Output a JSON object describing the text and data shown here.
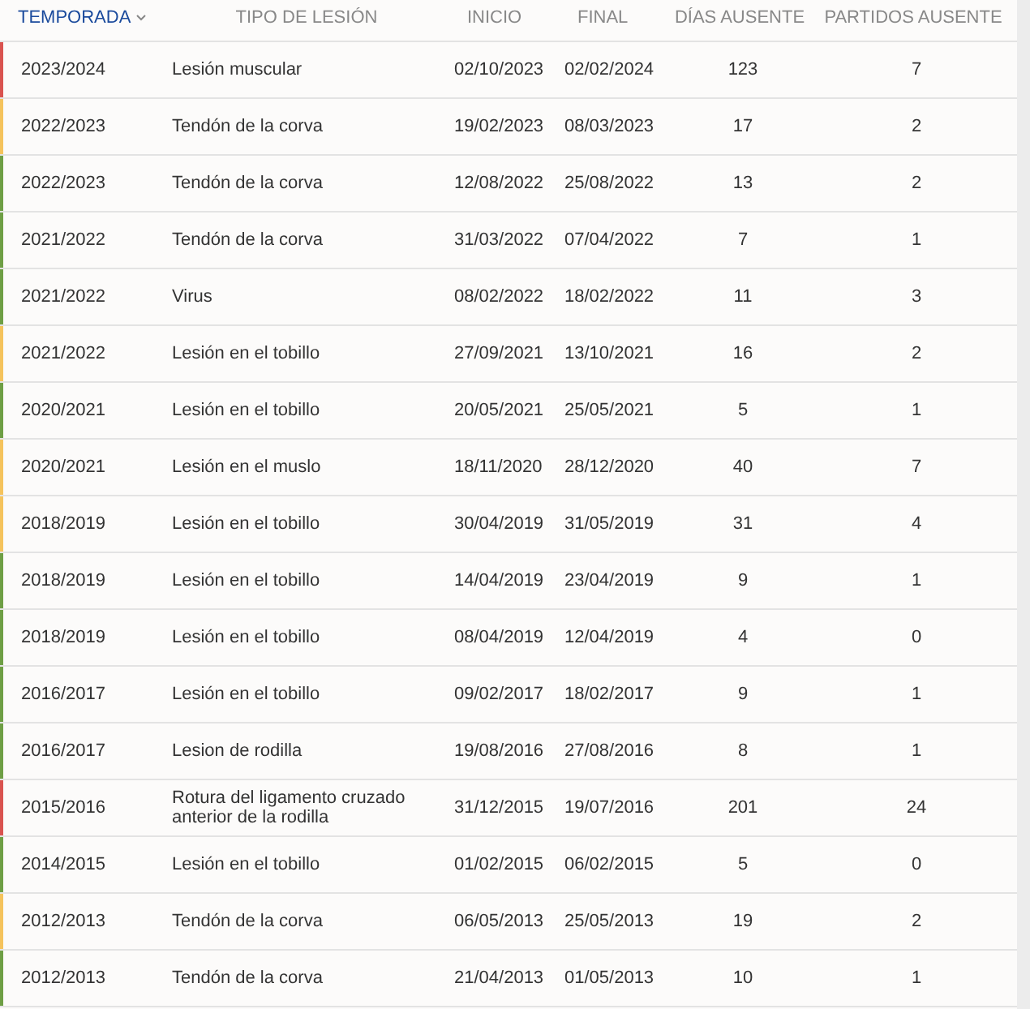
{
  "table": {
    "columns": [
      {
        "label": "TEMPORADA",
        "selected": true
      },
      {
        "label": "TIPO DE LESIÓN",
        "selected": false
      },
      {
        "label": "INICIO",
        "selected": false
      },
      {
        "label": "FINAL",
        "selected": false
      },
      {
        "label": "DÍAS AUSENTE",
        "selected": false
      },
      {
        "label": "PARTIDOS AUSENTE",
        "selected": false
      }
    ],
    "rows": [
      {
        "color": "#d9534f",
        "season": "2023/2024",
        "injury": "Lesión muscular",
        "start": "02/10/2023",
        "end": "02/02/2024",
        "days": "123",
        "games": "7"
      },
      {
        "color": "#f5c35c",
        "season": "2022/2023",
        "injury": "Tendón de la corva",
        "start": "19/02/2023",
        "end": "08/03/2023",
        "days": "17",
        "games": "2"
      },
      {
        "color": "#6e9f45",
        "season": "2022/2023",
        "injury": "Tendón de la corva",
        "start": "12/08/2022",
        "end": "25/08/2022",
        "days": "13",
        "games": "2"
      },
      {
        "color": "#6e9f45",
        "season": "2021/2022",
        "injury": "Tendón de la corva",
        "start": "31/03/2022",
        "end": "07/04/2022",
        "days": "7",
        "games": "1"
      },
      {
        "color": "#6e9f45",
        "season": "2021/2022",
        "injury": "Virus",
        "start": "08/02/2022",
        "end": "18/02/2022",
        "days": "11",
        "games": "3"
      },
      {
        "color": "#f5c35c",
        "season": "2021/2022",
        "injury": "Lesión en el tobillo",
        "start": "27/09/2021",
        "end": "13/10/2021",
        "days": "16",
        "games": "2"
      },
      {
        "color": "#6e9f45",
        "season": "2020/2021",
        "injury": "Lesión en el tobillo",
        "start": "20/05/2021",
        "end": "25/05/2021",
        "days": "5",
        "games": "1"
      },
      {
        "color": "#f5c35c",
        "season": "2020/2021",
        "injury": "Lesión en el muslo",
        "start": "18/11/2020",
        "end": "28/12/2020",
        "days": "40",
        "games": "7"
      },
      {
        "color": "#f5c35c",
        "season": "2018/2019",
        "injury": "Lesión en el tobillo",
        "start": "30/04/2019",
        "end": "31/05/2019",
        "days": "31",
        "games": "4"
      },
      {
        "color": "#6e9f45",
        "season": "2018/2019",
        "injury": "Lesión en el tobillo",
        "start": "14/04/2019",
        "end": "23/04/2019",
        "days": "9",
        "games": "1"
      },
      {
        "color": "#6e9f45",
        "season": "2018/2019",
        "injury": "Lesión en el tobillo",
        "start": "08/04/2019",
        "end": "12/04/2019",
        "days": "4",
        "games": "0"
      },
      {
        "color": "#6e9f45",
        "season": "2016/2017",
        "injury": "Lesión en el tobillo",
        "start": "09/02/2017",
        "end": "18/02/2017",
        "days": "9",
        "games": "1"
      },
      {
        "color": "#6e9f45",
        "season": "2016/2017",
        "injury": "Lesion de rodilla",
        "start": "19/08/2016",
        "end": "27/08/2016",
        "days": "8",
        "games": "1"
      },
      {
        "color": "#d9534f",
        "season": "2015/2016",
        "injury": "Rotura del ligamento cruzado anterior de la rodilla",
        "start": "31/12/2015",
        "end": "19/07/2016",
        "days": "201",
        "games": "24"
      },
      {
        "color": "#6e9f45",
        "season": "2014/2015",
        "injury": "Lesión en el tobillo",
        "start": "01/02/2015",
        "end": "06/02/2015",
        "days": "5",
        "games": "0"
      },
      {
        "color": "#f5c35c",
        "season": "2012/2013",
        "injury": "Tendón de la corva",
        "start": "06/05/2013",
        "end": "25/05/2013",
        "days": "19",
        "games": "2"
      },
      {
        "color": "#6e9f45",
        "season": "2012/2013",
        "injury": "Tendón de la corva",
        "start": "21/04/2013",
        "end": "01/05/2013",
        "days": "10",
        "games": "1"
      }
    ]
  }
}
